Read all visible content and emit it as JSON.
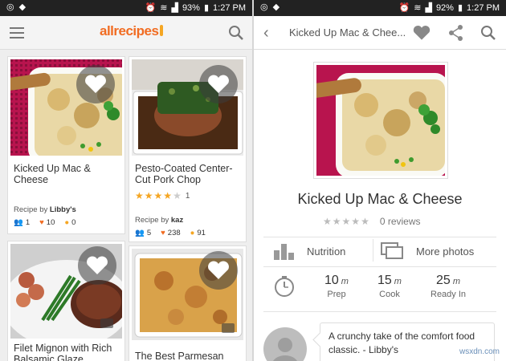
{
  "status_bar": {
    "left": {
      "battery": "93%",
      "time": "1:27 PM"
    },
    "right": {
      "battery": "92%",
      "time": "1:27 PM"
    }
  },
  "left_screen": {
    "brand": "allrecipes",
    "cards": [
      {
        "title": "Kicked Up Mac & Cheese",
        "recipe_by": "Libby's",
        "users": "1",
        "likes": "10",
        "tips": "0",
        "rating": null,
        "rating_count": ""
      },
      {
        "title": "Pesto-Coated Center-Cut Pork Chop",
        "recipe_by": "kaz",
        "users": "5",
        "likes": "238",
        "tips": "91",
        "rating": 4,
        "rating_count": "1"
      },
      {
        "title": "Filet Mignon with Rich Balsamic Glaze"
      },
      {
        "title": "The Best Parmesan"
      }
    ]
  },
  "right_screen": {
    "header_title": "Kicked Up Mac & Chee...",
    "recipe_title": "Kicked Up Mac & Cheese",
    "reviews": "0 reviews",
    "nutrition_label": "Nutrition",
    "more_photos_label": "More photos",
    "times": {
      "prep": {
        "value": "10",
        "unit": "m",
        "label": "Prep"
      },
      "cook": {
        "value": "15",
        "unit": "m",
        "label": "Cook"
      },
      "ready": {
        "value": "25",
        "unit": "m",
        "label": "Ready In"
      }
    },
    "description": "A crunchy take of the comfort food classic. - Libby's"
  },
  "watermark": "wsxdn.com",
  "colors": {
    "brand_orange": "#f16c22",
    "star_gold": "#f5a623"
  },
  "icons": [
    "whatsapp-icon",
    "dropbox-icon",
    "alarm-icon",
    "wifi-icon",
    "signal-icon",
    "battery-icon",
    "menu-icon",
    "search-icon",
    "back-icon",
    "heart-icon",
    "share-icon",
    "nutrition-icon",
    "photos-icon",
    "clock-icon",
    "users-icon",
    "tip-icon",
    "camera-icon"
  ]
}
